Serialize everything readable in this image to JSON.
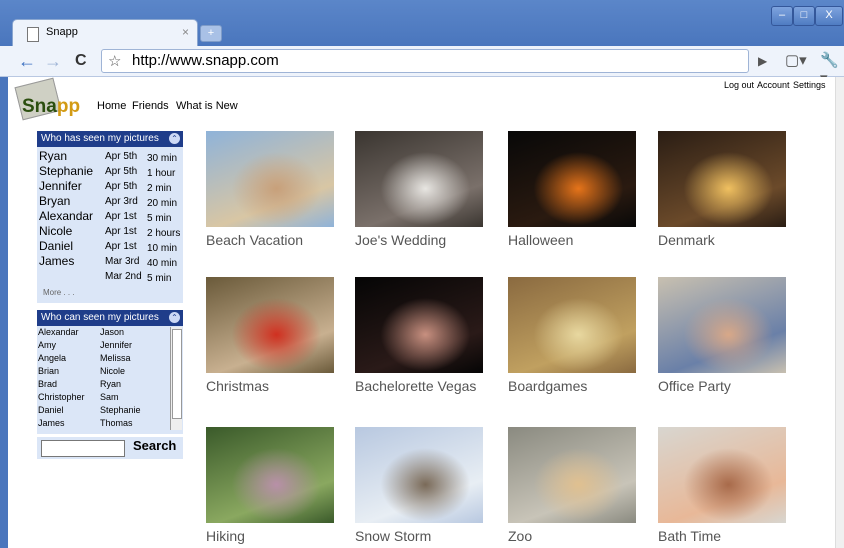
{
  "browser": {
    "tab_title": "Snapp",
    "tab_close": "×",
    "new_tab": "+",
    "url": "http://www.snapp.com",
    "window_buttons": {
      "minimize": "–",
      "maximize": "□",
      "close": "X"
    },
    "nav": {
      "back": "←",
      "forward": "→",
      "reload": "C",
      "star": "☆",
      "go": "▶",
      "page_menu": "▢▾",
      "tools_menu": "🔧▾"
    }
  },
  "site": {
    "logo": "Snapp",
    "nav": [
      "Home",
      "Friends",
      "What is New"
    ],
    "account_links": [
      "Log out",
      "Account",
      "Settings"
    ]
  },
  "seen_panel": {
    "title": "Who has seen my pictures",
    "collapse": "⌃",
    "entries": [
      {
        "name": "Ryan",
        "date": "Apr 5th",
        "duration": "30 min"
      },
      {
        "name": "Stephanie",
        "date": "Apr 5th",
        "duration": "1 hour"
      },
      {
        "name": "Jennifer",
        "date": "Apr 5th",
        "duration": "2 min"
      },
      {
        "name": "Bryan",
        "date": "Apr 3rd",
        "duration": "20 min"
      },
      {
        "name": "Alexandar",
        "date": "Apr 1st",
        "duration": "5 min"
      },
      {
        "name": "Nicole",
        "date": "Apr 1st",
        "duration": "2 hours"
      },
      {
        "name": "Daniel",
        "date": "Apr 1st",
        "duration": "10 min"
      },
      {
        "name": "James",
        "date": "Mar 3rd",
        "duration": "40 min"
      },
      {
        "name": "",
        "date": "Mar 2nd",
        "duration": "5 min"
      }
    ],
    "more": "More . . ."
  },
  "can_panel": {
    "title": "Who can seen my pictures",
    "collapse": "⌃",
    "col_a": [
      "Alexandar",
      "Amy",
      "Angela",
      "Brian",
      "Brad",
      "Christopher",
      "Daniel",
      "James"
    ],
    "col_b": [
      "Jason",
      "Jennifer",
      "Melissa",
      "Nicole",
      "Ryan",
      "Sam",
      "Stephanie",
      "Thomas"
    ]
  },
  "search": {
    "button": "Search",
    "value": ""
  },
  "albums": [
    {
      "title": "Beach Vacation",
      "colors": [
        "#8fb3d9",
        "#d8c6a4",
        "#c8a07a"
      ]
    },
    {
      "title": "Joe's Wedding",
      "colors": [
        "#3a3530",
        "#7a706a",
        "#e8e6e2"
      ]
    },
    {
      "title": "Halloween",
      "colors": [
        "#080808",
        "#2a1a10",
        "#e6741a"
      ]
    },
    {
      "title": "Denmark",
      "colors": [
        "#2a1d14",
        "#6b4a2a",
        "#f0c060"
      ]
    },
    {
      "title": "Christmas",
      "colors": [
        "#6a5a3a",
        "#c8b090",
        "#d03020"
      ]
    },
    {
      "title": "Bachelorette Vegas",
      "colors": [
        "#050505",
        "#2a1a18",
        "#c89080"
      ]
    },
    {
      "title": "Boardgames",
      "colors": [
        "#8a6a40",
        "#c0a060",
        "#e8d8a0"
      ]
    },
    {
      "title": "Office Party",
      "colors": [
        "#c8c0b0",
        "#6a80a8",
        "#d8a888"
      ]
    },
    {
      "title": "Hiking",
      "colors": [
        "#3a5a2a",
        "#8aa860",
        "#b890a8"
      ]
    },
    {
      "title": "Snow Storm",
      "colors": [
        "#b8c8e0",
        "#e8eef4",
        "#7a6a58"
      ]
    },
    {
      "title": "Zoo",
      "colors": [
        "#8a8a80",
        "#c8c4b8",
        "#e0c090"
      ]
    },
    {
      "title": "Bath Time",
      "colors": [
        "#d8d6d0",
        "#e8b898",
        "#a86a4a"
      ]
    }
  ]
}
